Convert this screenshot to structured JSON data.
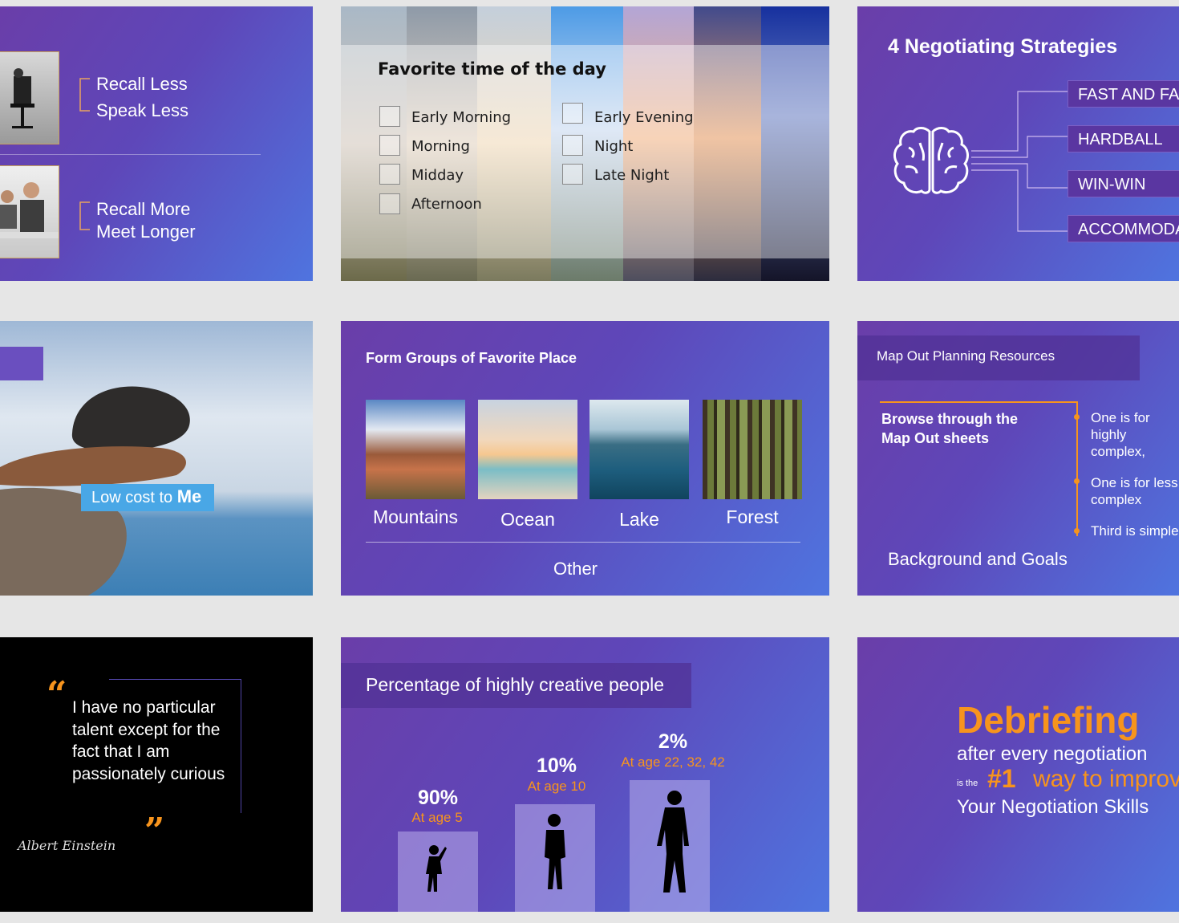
{
  "slide1": {
    "top_lines": [
      "Recall Less",
      "Speak Less"
    ],
    "bottom_lines": [
      "Recall More",
      "Meet Longer"
    ]
  },
  "slide2": {
    "title": "Favorite time of the day",
    "left_options": [
      "Early Morning",
      "Morning",
      "Midday",
      "Afternoon"
    ],
    "right_options": [
      "Early Evening",
      "Night",
      "Late Night"
    ]
  },
  "slide3": {
    "title": "4 Negotiating Strategies",
    "strategies": [
      "FAST AND FAIR",
      "HARDBALL",
      "WIN-WIN",
      "ACCOMMODATE"
    ],
    "icon": "brain-icon"
  },
  "slide4": {
    "caption_prefix": "Low cost to ",
    "caption_emphasis": "Me"
  },
  "slide5": {
    "title": "Form Groups of Favorite Place",
    "places": [
      "Mountains",
      "Ocean",
      "Lake",
      "Forest"
    ],
    "other": "Other"
  },
  "slide6": {
    "title": "Map Out Planning Resources",
    "browse": "Browse through the Map Out sheets",
    "bullets": [
      "One is for highly complex, multi-million dollar agreements",
      "One is for less complex negotiations",
      "Third is simple"
    ],
    "footer": "Background and Goals"
  },
  "slide7": {
    "quote": "I have no particular talent except for the fact that I am passionately curious",
    "open_mark": "“",
    "close_mark": "”",
    "signature": "Albert Einstein"
  },
  "slide8": {
    "title": "Percentage of highly creative people",
    "groups": [
      {
        "pct": "90%",
        "age": "At age 5",
        "value": 90
      },
      {
        "pct": "10%",
        "age": "At age 10",
        "value": 10
      },
      {
        "pct": "2%",
        "age": "At age 22, 32, 42",
        "value": 2
      }
    ]
  },
  "slide9": {
    "headline": "Debriefing",
    "line1": "after every negotiation",
    "is_the": "is the",
    "number": "#1",
    "way": "way to improve",
    "line3": "Your Negotiation Skills"
  },
  "colors": {
    "accent_orange": "#f7941d",
    "purple": "#6a3ea9",
    "blue": "#4f74df"
  }
}
